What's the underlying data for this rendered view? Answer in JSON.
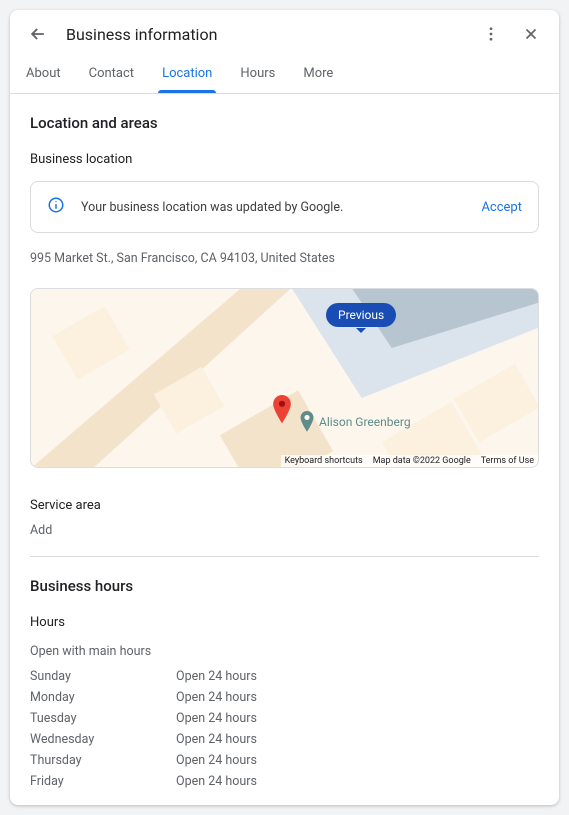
{
  "header": {
    "title": "Business information"
  },
  "tabs": [
    {
      "label": "About",
      "active": false
    },
    {
      "label": "Contact",
      "active": false
    },
    {
      "label": "Location",
      "active": true
    },
    {
      "label": "Hours",
      "active": false
    },
    {
      "label": "More",
      "active": false
    }
  ],
  "location": {
    "section_title": "Location and areas",
    "business_location_label": "Business location",
    "update_message": "Your business location was updated by Google.",
    "accept_label": "Accept",
    "address": "995 Market St., San Francisco, CA 94103, United States"
  },
  "map": {
    "previous_label": "Previous",
    "poi_label": "Alison Greenberg",
    "footer": {
      "shortcuts": "Keyboard shortcuts",
      "copyright": "Map data ©2022 Google",
      "terms": "Terms of Use"
    }
  },
  "service_area": {
    "label": "Service area",
    "add_label": "Add"
  },
  "hours": {
    "section_title": "Business hours",
    "sub_label": "Hours",
    "status": "Open with main hours",
    "rows": [
      {
        "day": "Sunday",
        "value": "Open 24 hours"
      },
      {
        "day": "Monday",
        "value": "Open 24 hours"
      },
      {
        "day": "Tuesday",
        "value": "Open 24 hours"
      },
      {
        "day": "Wednesday",
        "value": "Open 24 hours"
      },
      {
        "day": "Thursday",
        "value": "Open 24 hours"
      },
      {
        "day": "Friday",
        "value": "Open 24 hours"
      }
    ]
  }
}
